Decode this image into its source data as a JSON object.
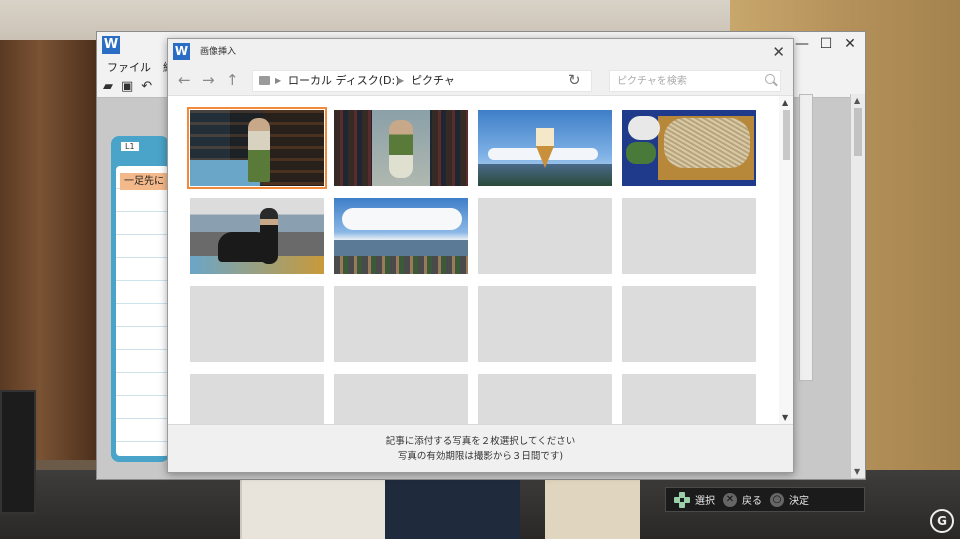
{
  "back_window": {
    "menu": [
      "ファイル",
      "編集"
    ],
    "doc_tag": "L1",
    "doc_line": "一足先に"
  },
  "dialog": {
    "title": "画像挿入",
    "path": [
      "ローカル ディスク(D:)",
      "ピクチャ"
    ],
    "search_placeholder": "ピクチャを検索",
    "footer_line1": "記事に添付する写真を２枚選択してください",
    "footer_line2": "写真の有効期限は撮影から３日間です)"
  },
  "thumbnails": [
    {
      "photo": "library-girl-standing",
      "selected": true
    },
    {
      "photo": "library-girl-sitting",
      "selected": false
    },
    {
      "photo": "soft-serve-lake",
      "selected": false
    },
    {
      "photo": "soba-noodles",
      "selected": false
    },
    {
      "photo": "motorcycle-rider",
      "selected": false
    },
    {
      "photo": "lake-view",
      "selected": false
    },
    {
      "photo": "empty"
    },
    {
      "photo": "empty"
    },
    {
      "photo": "empty"
    },
    {
      "photo": "empty"
    },
    {
      "photo": "empty"
    },
    {
      "photo": "empty"
    },
    {
      "photo": "empty"
    },
    {
      "photo": "empty"
    },
    {
      "photo": "empty"
    },
    {
      "photo": "empty"
    }
  ],
  "accent_color": "#f28a3a",
  "guide": {
    "select": "選択",
    "back": "戻る",
    "confirm": "決定"
  }
}
